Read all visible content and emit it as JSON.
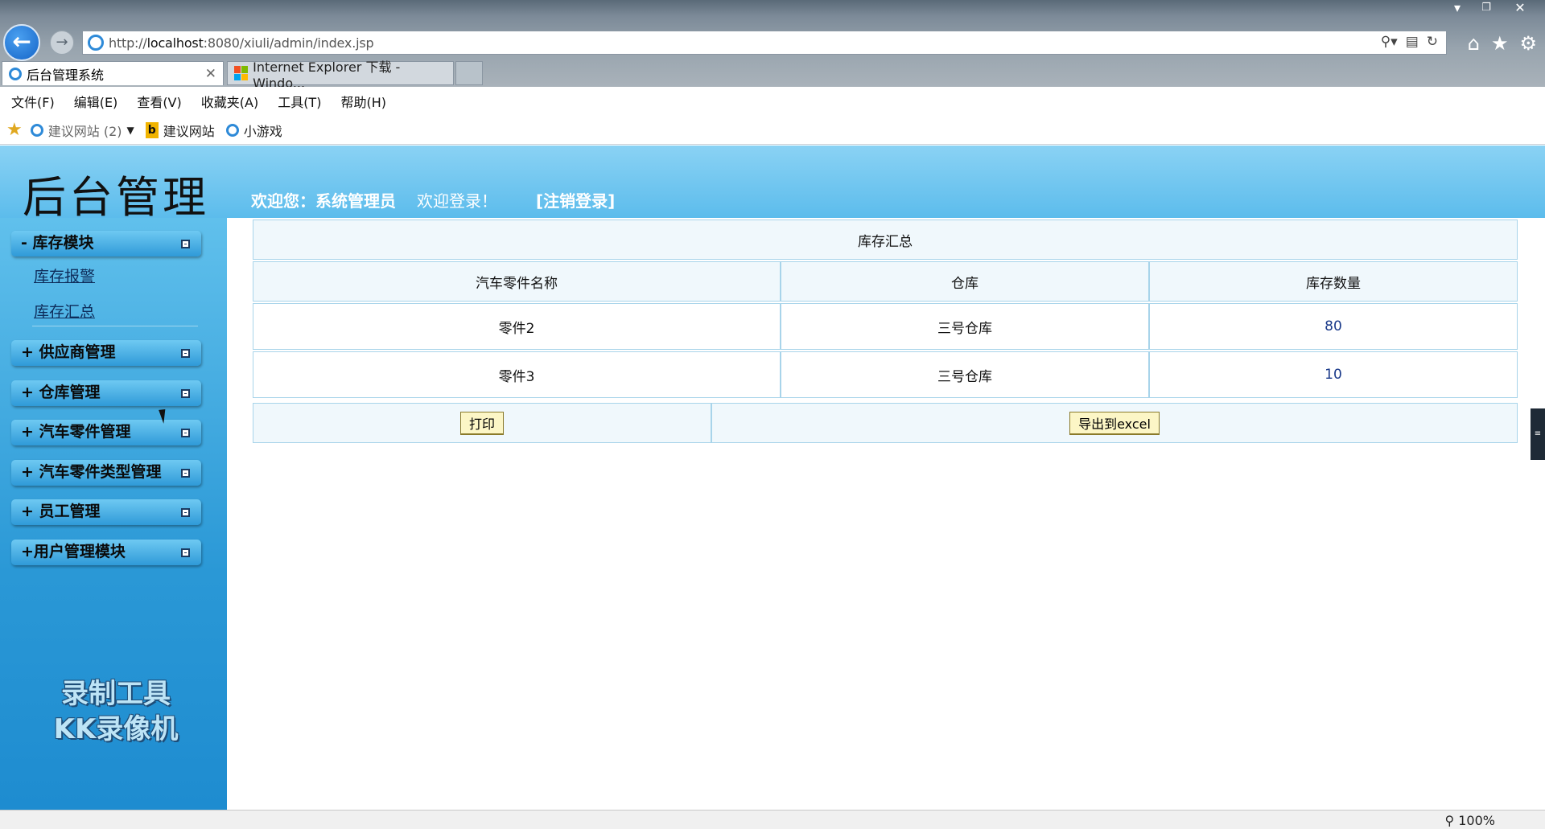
{
  "browser": {
    "address_url_prefix": "http://",
    "address_url_host": "localhost",
    "address_url_rest": ":8080/xiuli/admin/index.jsp",
    "tabs": [
      {
        "label": "后台管理系统"
      },
      {
        "label": "Internet Explorer 下载 - Windo..."
      }
    ],
    "menu": [
      "文件(F)",
      "编辑(E)",
      "查看(V)",
      "收藏夹(A)",
      "工具(T)",
      "帮助(H)"
    ],
    "favorites": {
      "suggested_sites": "建议网站 (2)",
      "suggested_sites_2": "建议网站",
      "games": "小游戏"
    },
    "zoom": "100%"
  },
  "header": {
    "brand": "后台管理",
    "welcome_user": "欢迎您：系统管理员",
    "welcome_msg": "欢迎登录！",
    "logout": "[注销登录]"
  },
  "sidebar": {
    "sections": [
      {
        "label": "- 库存模块",
        "expanded": true
      },
      {
        "label": "+ 供应商管理"
      },
      {
        "label": "+ 仓库管理"
      },
      {
        "label": "+ 汽车零件管理"
      },
      {
        "label": "+ 汽车零件类型管理"
      },
      {
        "label": "+ 员工管理"
      },
      {
        "label": "+用户管理模块"
      }
    ],
    "sub_items": [
      "库存报警",
      "库存汇总"
    ],
    "watermark_line1": "录制工具",
    "watermark_line2": "KK录像机"
  },
  "inventory": {
    "title": "库存汇总",
    "columns": [
      "汽车零件名称",
      "仓库",
      "库存数量"
    ],
    "rows": [
      {
        "name": "零件2",
        "warehouse": "三号仓库",
        "qty": "80"
      },
      {
        "name": "零件3",
        "warehouse": "三号仓库",
        "qty": "10"
      }
    ],
    "print_label": "打印",
    "export_label": "导出到excel"
  },
  "colors": {
    "header_blue": "#5cbcec",
    "sidebar_blue": "#2a98d6",
    "table_bg": "#f0f8fc",
    "table_border": "#a8d4ea",
    "button_bg": "#fcf6c6"
  }
}
